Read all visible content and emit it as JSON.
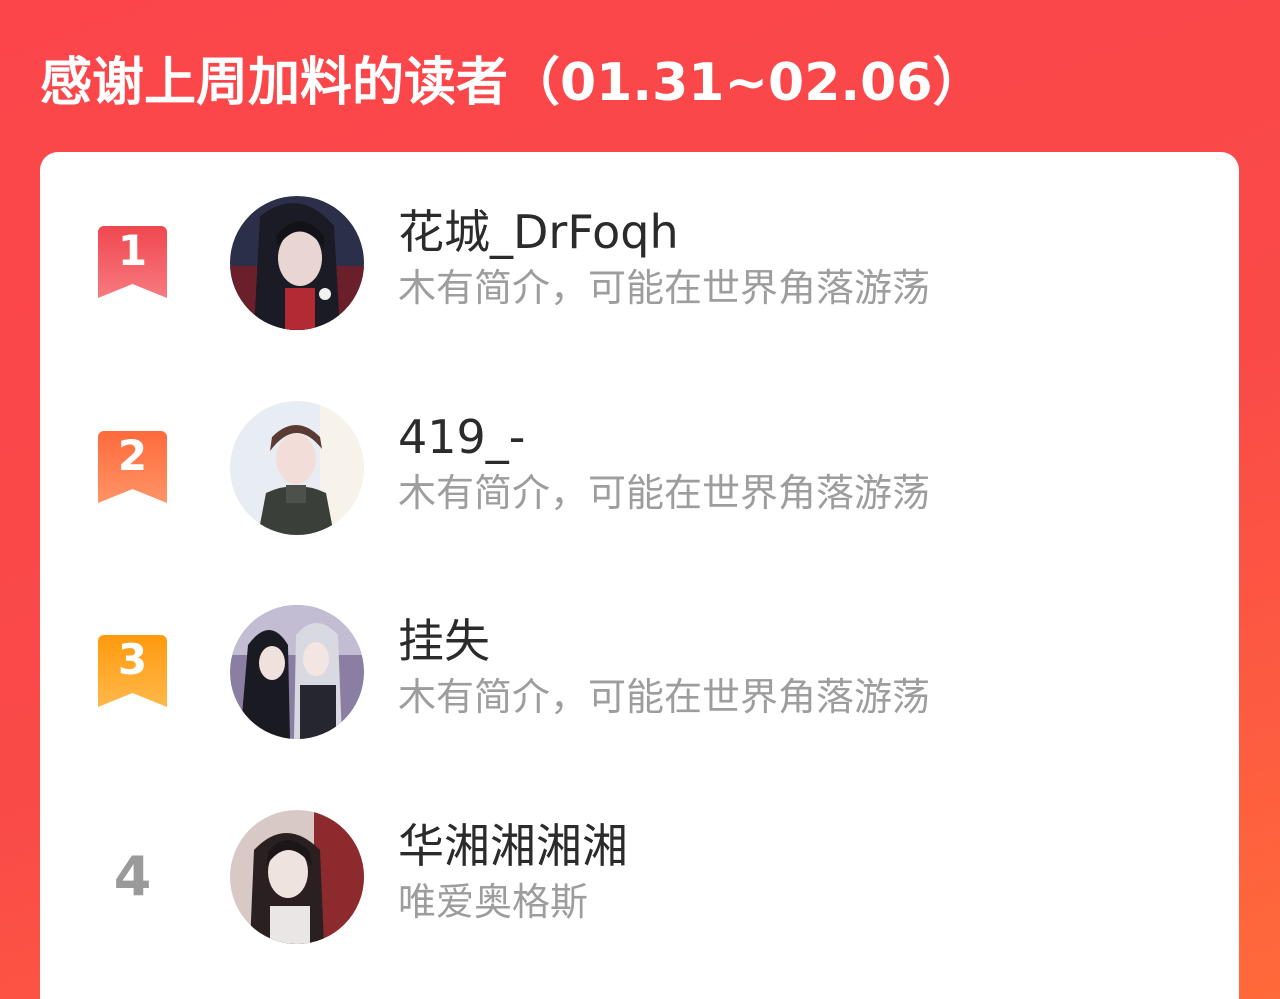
{
  "header": {
    "title": "感谢上周加料的读者（01.31~02.06）"
  },
  "colors": {
    "background_start": "#fb454b",
    "background_end": "#ff6a3a",
    "rank_1": "#f5555c",
    "rank_2": "#ff7a45",
    "rank_3": "#ffa21d",
    "rank_plain": "#9a9a9a",
    "name_text": "#2b2b2b",
    "bio_text": "#9d9d9d"
  },
  "readers": [
    {
      "rank": "1",
      "name": "花城_DrFoqh",
      "bio": "木有简介，可能在世界角落游荡",
      "avatar_icon": "avatar-image"
    },
    {
      "rank": "2",
      "name": "419_-",
      "bio": "木有简介，可能在世界角落游荡",
      "avatar_icon": "avatar-image"
    },
    {
      "rank": "3",
      "name": "挂失",
      "bio": "木有简介，可能在世界角落游荡",
      "avatar_icon": "avatar-image"
    },
    {
      "rank": "4",
      "name": "华湘湘湘湘",
      "bio": "唯爱奥格斯",
      "avatar_icon": "avatar-image"
    }
  ]
}
